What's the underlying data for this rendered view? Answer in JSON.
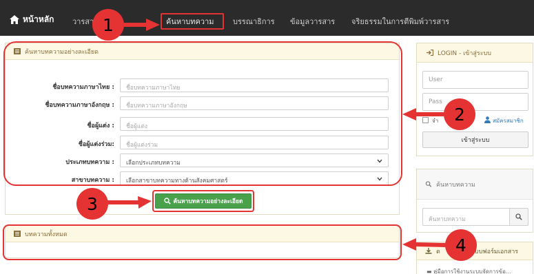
{
  "navbar": {
    "home_label": "หน้าหลัก",
    "items": [
      {
        "label": "วารสาร"
      },
      {
        "label": "ค้นหาบทความ"
      },
      {
        "label": "บรรณาธิการ"
      },
      {
        "label": "ข้อมูลวารสาร"
      },
      {
        "label": "จริยธรรมในการตีพิมพ์วารสาร"
      }
    ]
  },
  "advanced_search": {
    "title": "ค้นหาบทความอย่างละเอียด",
    "fields": [
      {
        "label": "ชื่อบทความภาษาไทย :",
        "placeholder": "ชื่อบทความภาษาไทย"
      },
      {
        "label": "ชื่อบทความภาษาอังกฤษ :",
        "placeholder": "ชื่อบทความภาษาอังกฤษ"
      },
      {
        "label": "ชื่อผู้แต่ง :",
        "placeholder": "ชื่อผู้แต่ง"
      },
      {
        "label": "ชื่อผู้แต่งร่วม:",
        "placeholder": "ชื่อผู้แต่งร่วม"
      },
      {
        "label": "ประเภทบทความ :",
        "value": "เลือกประเภทบทความ"
      },
      {
        "label": "สาขาบทความ :",
        "value": "เลือกสาขาบทความทางด้านสังคมศาสตร์"
      }
    ],
    "button_label": "ค้นหาบทความอย่างละเอียด"
  },
  "all_articles": {
    "title": "บทความทั้งหมด"
  },
  "login": {
    "title": "LOGIN - เข้าสู่ระบบ",
    "user_placeholder": "User",
    "pass_placeholder": "Pass",
    "remember_label": "จำ",
    "register_label": "สมัครสมาชิก",
    "login_button": "เข้าสู่ระบบ"
  },
  "sidebar_search": {
    "title": "ค้นหาบทความ",
    "placeholder": "ค้นหาบทความ"
  },
  "downloads": {
    "title": "ดาวน์โหลดแบบฟอร์มเอกสาร",
    "visible_title": "ด",
    "visible_title_tail": "บบฟอร์มเอกสาร",
    "item": "คู่มือการใช้งานระบบจัดการข้อ..."
  },
  "callouts": [
    "1",
    "2",
    "3",
    "4"
  ],
  "colors": {
    "navbar": "#2b2b2b",
    "annotation_red": "#e53232",
    "panel_head": "#fcf8e3",
    "search_button": "#49a14b"
  }
}
